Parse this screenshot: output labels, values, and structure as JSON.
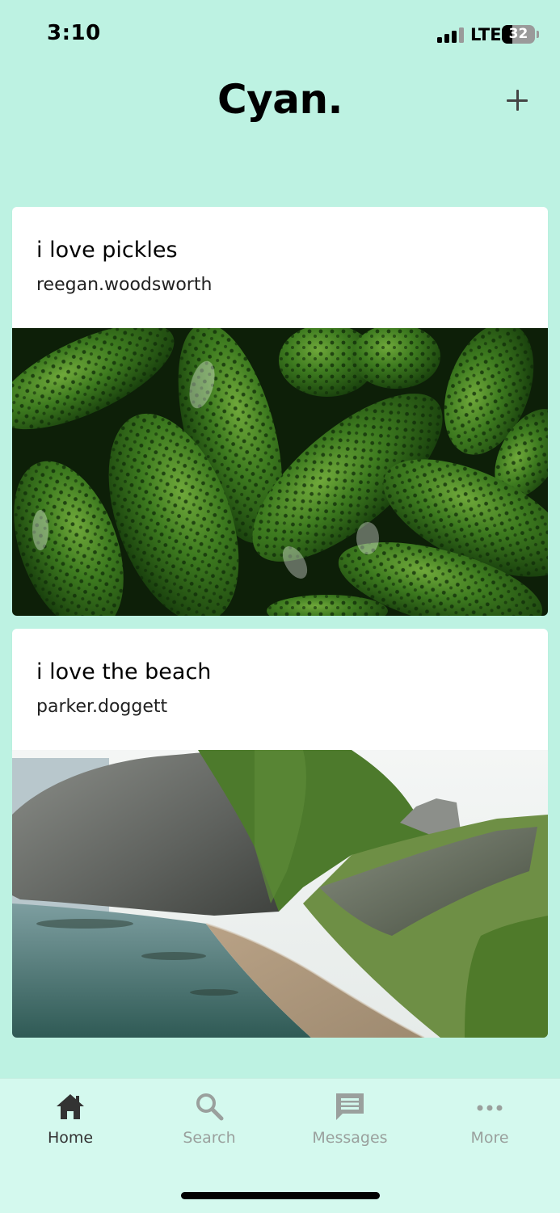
{
  "status_bar": {
    "time": "3:10",
    "network": "LTE",
    "battery_percent": "32",
    "signal_bars": 3
  },
  "header": {
    "title": "Cyan.",
    "add_icon": "plus-icon"
  },
  "posts": [
    {
      "title": "i love pickles",
      "author": "reegan.woodsworth",
      "image": "pickles-photo"
    },
    {
      "title": "i love the beach",
      "author": "parker.doggett",
      "image": "beach-cliff-photo"
    }
  ],
  "tab_bar": {
    "tabs": [
      {
        "label": "Home",
        "icon": "home-icon",
        "active": true
      },
      {
        "label": "Search",
        "icon": "search-icon",
        "active": false
      },
      {
        "label": "Messages",
        "icon": "message-icon",
        "active": false
      },
      {
        "label": "More",
        "icon": "more-icon",
        "active": false
      }
    ]
  },
  "colors": {
    "background": "#bdf2e2",
    "tab_bar": "#d4f9ee",
    "card": "#ffffff",
    "active_tab": "#333333",
    "inactive_tab": "#9aa09d"
  }
}
